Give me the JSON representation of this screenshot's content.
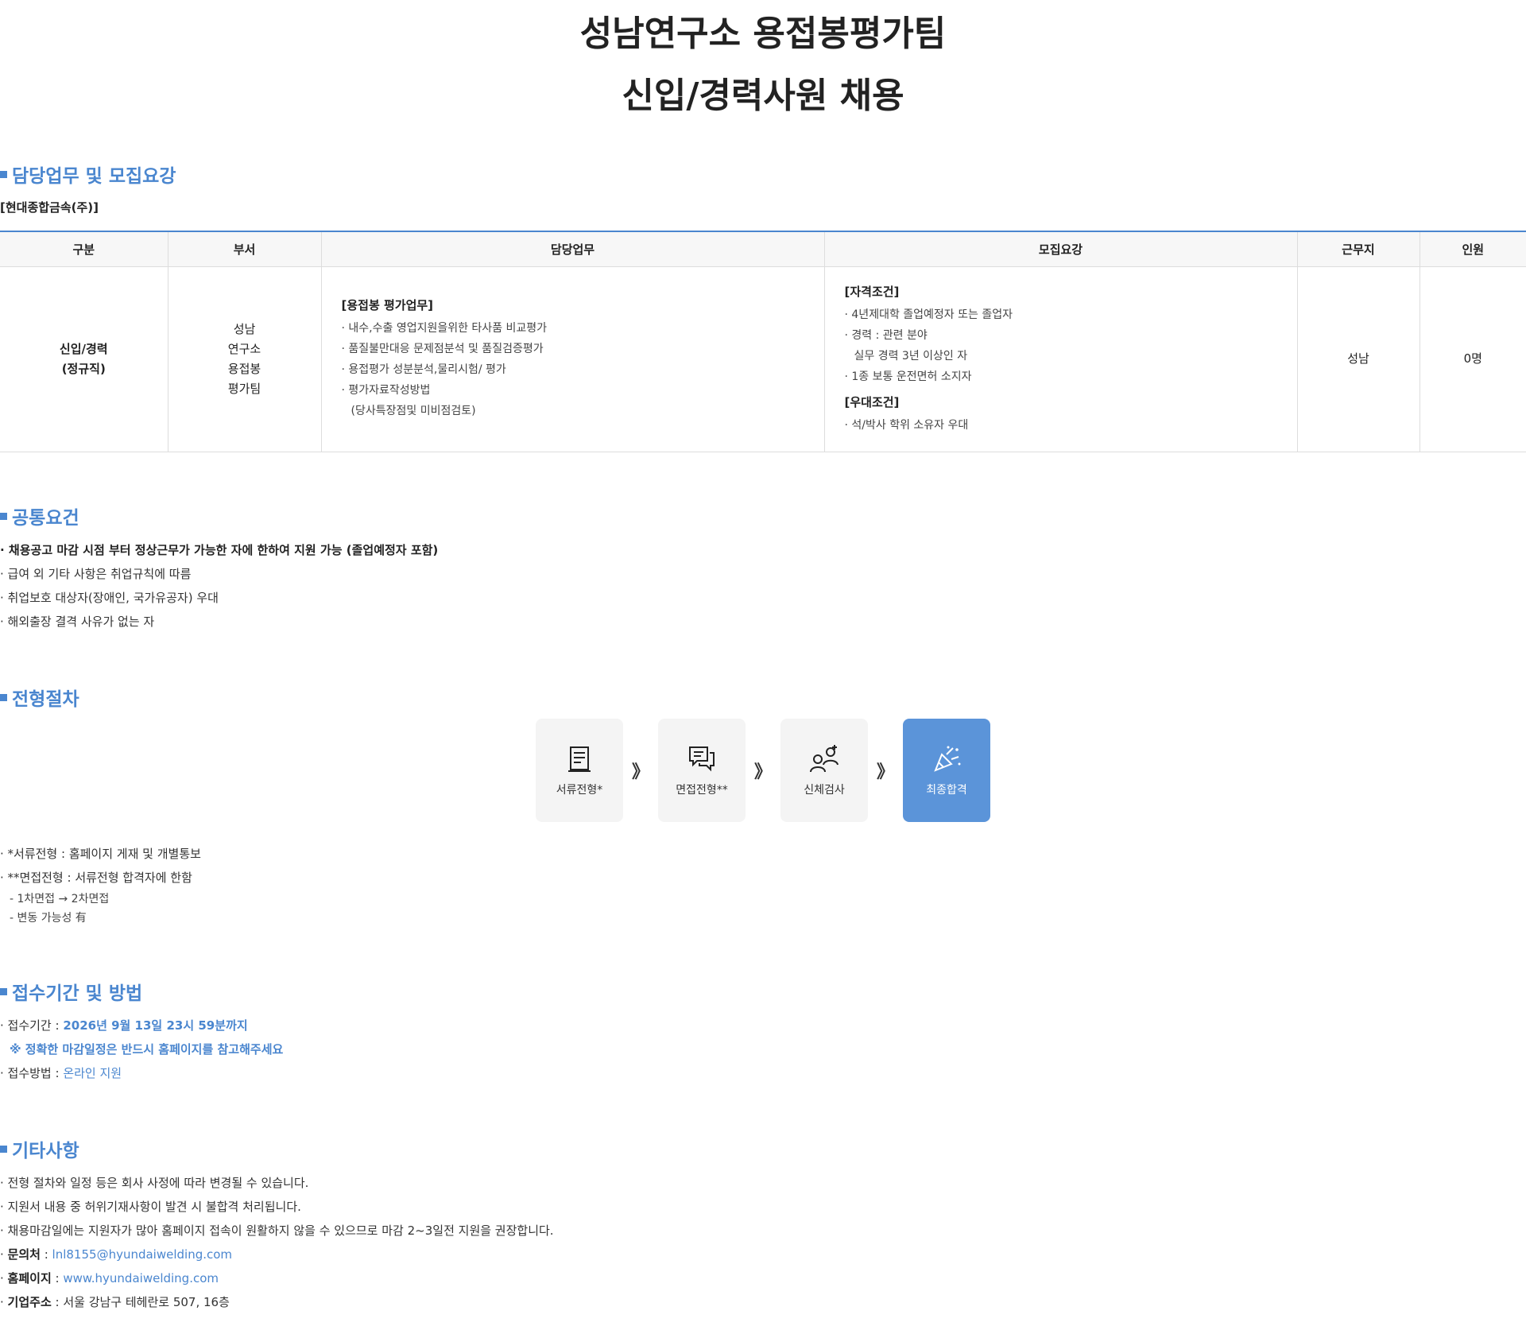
{
  "header": {
    "title_line1": "성남연구소 용접봉평가팀",
    "title_line2": "신입/경력사원 채용"
  },
  "duties": {
    "heading": "담당업무 및 모집요강",
    "company": "[현대종합금속(주)]",
    "columns": [
      "구분",
      "부서",
      "담당업무",
      "모집요강",
      "근무지",
      "인원"
    ],
    "row": {
      "category_1": "신입/경력",
      "category_2": "(정규직)",
      "dept": [
        "성남",
        "연구소",
        "용접봉",
        "평가팀"
      ],
      "task_head": "[용접봉 평가업무]",
      "tasks": [
        "· 내수,수출 영업지원을위한 타사품 비교평가",
        "· 품질불만대응 문제점분석 및 품질검증평가",
        "· 용접평가 성분분석,물리시험/ 평가",
        "· 평가자료작성방법",
        "(당사특장점및 미비점검토)"
      ],
      "req_head_1": "[자격조건]",
      "reqs_1": [
        "· 4년제대학 졸업예정자 또는 졸업자",
        "· 경력 : 관련 분야",
        "실무 경력 3년 이상인 자",
        "· 1종 보통 운전면허 소지자"
      ],
      "req_head_2": "[우대조건]",
      "reqs_2": [
        "· 석/박사 학위 소유자 우대"
      ],
      "location": "성남",
      "headcount": "0명"
    }
  },
  "common": {
    "heading": "공통요건",
    "items": [
      "· 채용공고 마감 시점 부터 정상근무가 가능한 자에 한하여 지원 가능 (졸업예정자 포함)",
      "· 급여 외 기타 사항은 취업규칙에 따름",
      "· 취업보호 대상자(장애인, 국가유공자) 우대",
      "· 해외출장 결격 사유가 없는 자"
    ]
  },
  "process": {
    "heading": "전형절차",
    "steps": [
      {
        "label": "서류전형*",
        "icon": "document-icon"
      },
      {
        "label": "면접전형**",
        "icon": "chat-bubbles-icon"
      },
      {
        "label": "신체검사",
        "icon": "medical-check-icon"
      },
      {
        "label": "최종합격",
        "icon": "party-popper-icon"
      }
    ],
    "arrow": "》",
    "notes": [
      "· *서류전형 : 홈페이지 게재 및 개별통보",
      "· **면접전형 : 서류전형 합격자에 한함"
    ],
    "subnotes": [
      "- 1차면접 → 2차면접",
      "- 변동 가능성 有"
    ]
  },
  "apply": {
    "heading": "접수기간 및 방법",
    "period_label": "· 접수기간 : ",
    "period_value": "2026년 9월 13일 23시 59분까지",
    "period_note": "※ 정확한 마감일정은 반드시 홈페이지를 참고해주세요",
    "method_label": "· 접수방법 : ",
    "method_value": "온라인 지원"
  },
  "misc": {
    "heading": "기타사항",
    "items": [
      "· 전형 절차와 일정 등은 회사 사정에 따라 변경될 수 있습니다.",
      "· 지원서 내용 중 허위기재사항이 발견 시 불합격 처리됩니다.",
      "· 채용마감일에는 지원자가 많아 홈페이지 접속이 원활하지 않을 수 있으므로 마감 2~3일전 지원을 권장합니다."
    ],
    "contact_label": "문의처",
    "contact_value": "lnl8155@hyundaiwelding.com",
    "homepage_label": "홈페이지",
    "homepage_value": "www.hyundaiwelding.com",
    "address_label": "기업주소",
    "address_value": "서울 강남구 테헤란로 507, 16층",
    "sep": " : ",
    "bullet": "· "
  },
  "colors": {
    "accent": "#4a86cf",
    "final_step": "#5b94d9"
  }
}
